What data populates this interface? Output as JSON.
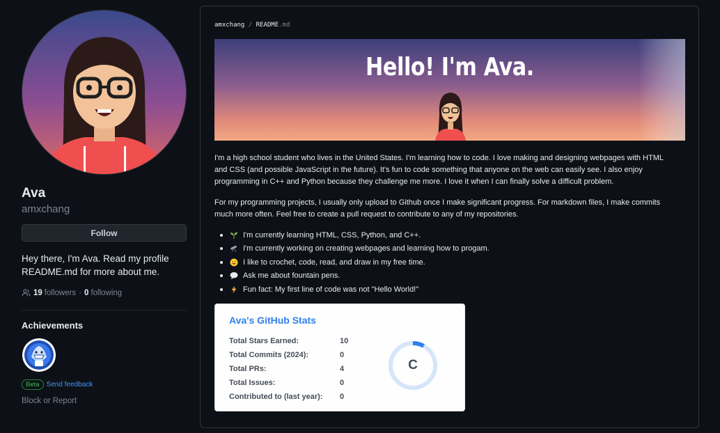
{
  "profile": {
    "name": "Ava",
    "login": "amxchang",
    "follow_label": "Follow",
    "bio": "Hey there, I'm Ava. Read my profile README.md for more about me.",
    "followers_count": "19",
    "followers_label": "followers",
    "separator": "·",
    "following_count": "0",
    "following_label": "following"
  },
  "achievements": {
    "title": "Achievements",
    "beta_label": "Beta",
    "feedback_label": "Send feedback"
  },
  "block_label": "Block or Report",
  "readme": {
    "crumb_user": "amxchang",
    "crumb_sep": "/",
    "crumb_file": "README",
    "crumb_ext": ".md",
    "banner_title": "Hello! I'm Ava.",
    "paragraph_1": "I'm a high school student who lives in the United States. I'm learning how to code. I love making and designing webpages with HTML and CSS (and possible JavaScript in the future). It's fun to code something that anyone on the web can easily see. I also enjoy programming in C++ and Python because they challenge me more. I love it when I can finally solve a difficult problem.",
    "paragraph_2": "For my programming projects, I usually only upload to Github once I make significant progress. For markdown files, I make commits much more often. Feel free to create a pull request to contribute to any of my repositories.",
    "bullets": [
      {
        "icon": "seedling-icon",
        "text": "I'm currently learning HTML, CSS, Python, and C++."
      },
      {
        "icon": "telescope-icon",
        "text": "I'm currently working on creating webpages and learning how to progam."
      },
      {
        "icon": "smile-icon",
        "text": "I like to crochet, code, read, and draw in my free time."
      },
      {
        "icon": "speech-bubble-icon",
        "text": "Ask me about fountain pens."
      },
      {
        "icon": "lightning-icon",
        "text": "Fun fact: My first line of code was not \"Hello World!\""
      }
    ]
  },
  "stats_card": {
    "title": "Ava's GitHub Stats",
    "rows": [
      {
        "label": "Total Stars Earned:",
        "value": "10"
      },
      {
        "label": "Total Commits (2024):",
        "value": "0"
      },
      {
        "label": "Total PRs:",
        "value": "4"
      },
      {
        "label": "Total Issues:",
        "value": "0"
      },
      {
        "label": "Contributed to (last year):",
        "value": "0"
      }
    ],
    "rank": "C",
    "rank_progress": 0.08,
    "colors": {
      "title": "#2f80ed",
      "ring": "#2f80ed",
      "text": "#434d58"
    }
  }
}
